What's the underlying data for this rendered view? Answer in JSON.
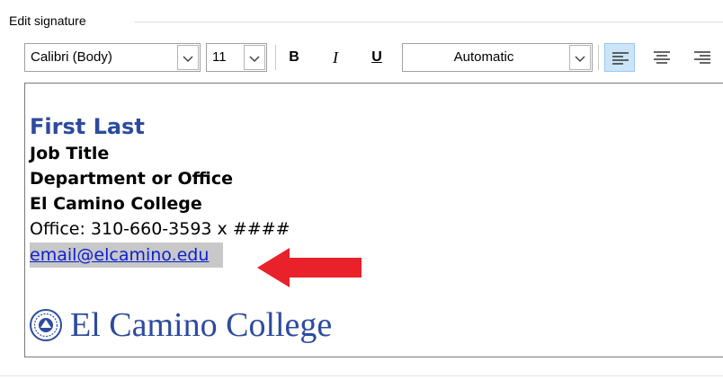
{
  "group": {
    "label": "Edit signature"
  },
  "toolbar": {
    "font_name": "Calibri (Body)",
    "font_size": "11",
    "bold_label": "B",
    "italic_label": "I",
    "underline_label": "U",
    "font_color": "Automatic",
    "align_left_icon": "align-left-icon",
    "align_center_icon": "align-center-icon",
    "align_right_icon": "align-right-icon"
  },
  "signature": {
    "name": "First Last",
    "job_title": "Job Title",
    "department": "Department or Office",
    "college": "El Camino College",
    "office": "Office: 310-660-3593 x ####",
    "email": "email@elcamino.edu",
    "logo_text": "El Camino College"
  },
  "colors": {
    "name_blue": "#2d4b9e",
    "link_blue": "#0b1fcf",
    "highlight_gray": "#c8c8c8",
    "arrow_red": "#e8212b",
    "active_button": "#cce4f7"
  }
}
